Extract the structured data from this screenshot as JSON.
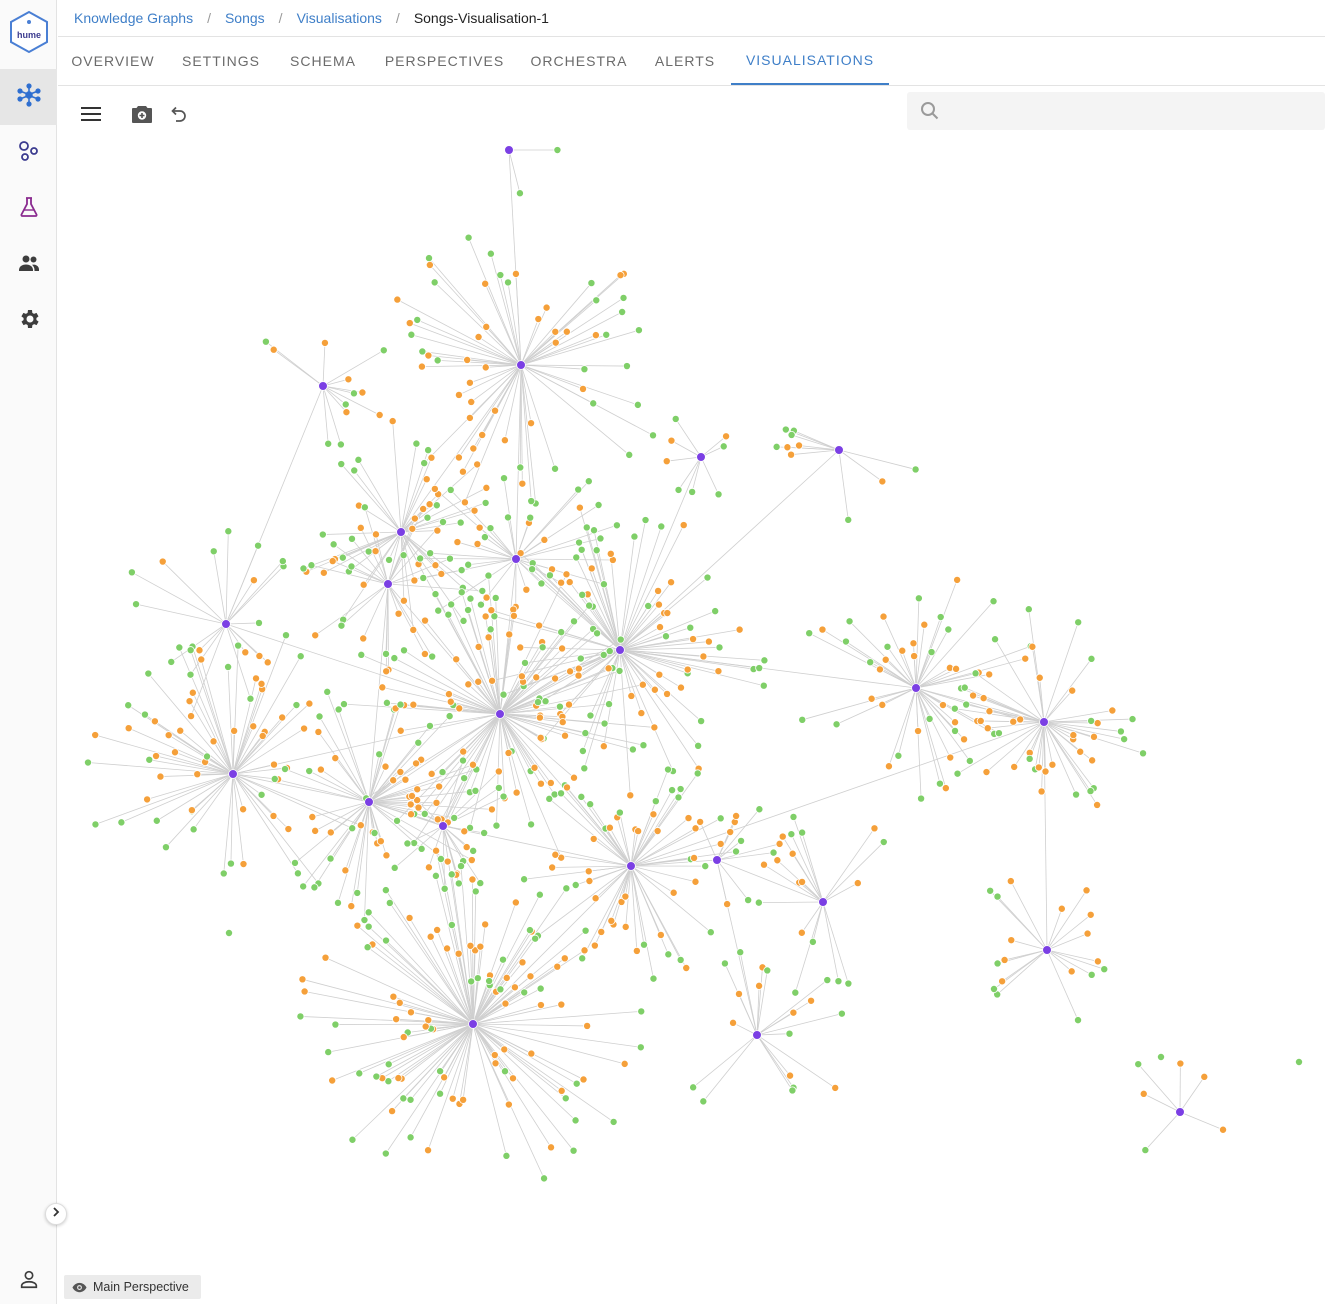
{
  "app": {
    "logo_text": "hume"
  },
  "rail": {
    "items": [
      {
        "name": "knowledge-graphs",
        "icon": "graph-network-icon",
        "active": true
      },
      {
        "name": "schema",
        "icon": "nodes-icon",
        "active": false
      },
      {
        "name": "labs",
        "icon": "flask-icon",
        "active": false
      },
      {
        "name": "users",
        "icon": "people-icon",
        "active": false
      },
      {
        "name": "settings",
        "icon": "gear-icon",
        "active": false
      }
    ],
    "footer_icon": "user-icon",
    "toggle_icon": "chevron-right-icon"
  },
  "breadcrumb": {
    "items": [
      "Knowledge Graphs",
      "Songs",
      "Visualisations"
    ],
    "separator": "/",
    "current": "Songs-Visualisation-1"
  },
  "tabs": [
    {
      "label": "OVERVIEW",
      "active": false
    },
    {
      "label": "SETTINGS",
      "active": false
    },
    {
      "label": "SCHEMA",
      "active": false
    },
    {
      "label": "PERSPECTIVES",
      "active": false
    },
    {
      "label": "ORCHESTRA",
      "active": false
    },
    {
      "label": "ALERTS",
      "active": false
    },
    {
      "label": "VISUALISATIONS",
      "active": true
    }
  ],
  "toolbar": {
    "menu_icon": "hamburger-menu-icon",
    "snapshot_icon": "camera-icon",
    "undo_icon": "undo-icon",
    "search_icon": "search-icon",
    "search_value": "",
    "search_placeholder": ""
  },
  "perspective": {
    "label": "Main Perspective",
    "icon": "eye-icon"
  },
  "colors": {
    "accent": "#3f7fc8",
    "hub_node": "#7b3fe4",
    "orange_node": "#f5a03a",
    "green_node": "#7fcf68",
    "edge": "#cfcfcf"
  }
}
